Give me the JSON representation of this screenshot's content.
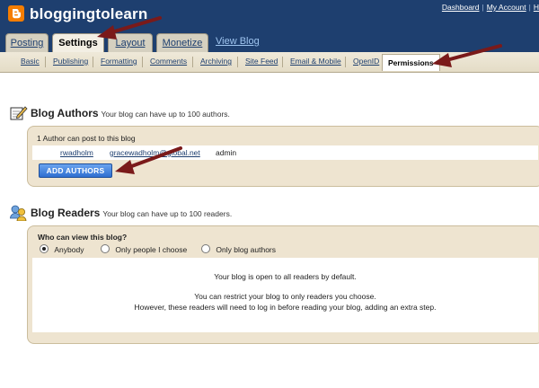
{
  "header": {
    "blog_title": "bloggingtolearn",
    "top_links": [
      "Dashboard",
      "My Account",
      "H"
    ],
    "tabs": [
      "Posting",
      "Settings",
      "Layout",
      "Monetize"
    ],
    "active_tab": "Settings",
    "view_blog": "View Blog",
    "colors": {
      "header_bg": "#1e3f6f",
      "logo": "#f57d00"
    }
  },
  "subtabs": {
    "items": [
      "Basic",
      "Publishing",
      "Formatting",
      "Comments",
      "Archiving",
      "Site Feed",
      "Email & Mobile",
      "OpenID",
      "Permissions"
    ],
    "active": "Permissions"
  },
  "authors": {
    "title": "Blog Authors",
    "subtitle": "Your blog can have up to 100 authors.",
    "count_text": "1 Author can post to this blog",
    "rows": [
      {
        "name": "rwadholm",
        "email": "gracewadholm@global.net",
        "role": "admin"
      }
    ],
    "add_button": "ADD AUTHORS"
  },
  "readers": {
    "title": "Blog Readers",
    "subtitle": "Your blog can have up to 100 readers.",
    "question": "Who can view this blog?",
    "options": [
      "Anybody",
      "Only people I choose",
      "Only blog authors"
    ],
    "selected": "Anybody",
    "message1": "Your blog is open to all readers by default.",
    "message2": "You can restrict your blog to only readers you choose.",
    "message3": "However, these readers will need to log in before reading your blog, adding an extra step."
  },
  "annotation_arrows": {
    "color": "#8b1a1a",
    "count": 3
  }
}
